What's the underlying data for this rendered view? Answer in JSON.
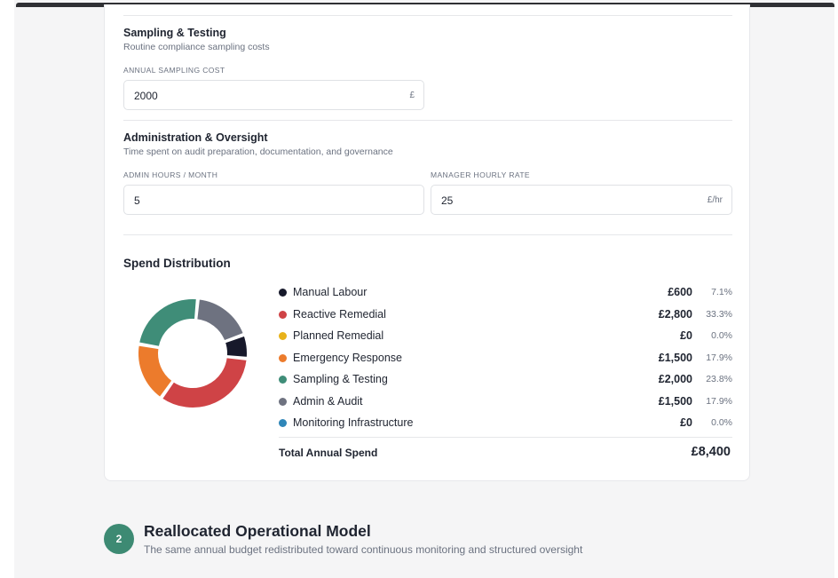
{
  "colors": {
    "manual_labour": "#17192b",
    "reactive_remedial": "#cf4346",
    "planned_remedial": "#e8b21a",
    "emergency_response": "#ec7b2c",
    "sampling_testing": "#3f8d78",
    "admin_audit": "#6e7280",
    "monitoring_infrastructure": "#2f86b8",
    "accent": "#3d8a73"
  },
  "sampling": {
    "title": "Sampling & Testing",
    "subtitle": "Routine compliance sampling costs",
    "cost_label": "ANNUAL SAMPLING COST",
    "cost_value": "2000",
    "cost_unit": "£"
  },
  "admin": {
    "title": "Administration & Oversight",
    "subtitle": "Time spent on audit preparation, documentation, and governance",
    "hours_label": "ADMIN HOURS / MONTH",
    "hours_value": "5",
    "rate_label": "MANAGER HOURLY RATE",
    "rate_value": "25",
    "rate_unit": "£/hr"
  },
  "distribution": {
    "title": "Spend Distribution",
    "items": [
      {
        "label": "Manual Labour",
        "amount": "£600",
        "percent": "7.1%",
        "color_key": "manual_labour",
        "fraction": 0.071
      },
      {
        "label": "Reactive Remedial",
        "amount": "£2,800",
        "percent": "33.3%",
        "color_key": "reactive_remedial",
        "fraction": 0.333
      },
      {
        "label": "Planned Remedial",
        "amount": "£0",
        "percent": "0.0%",
        "color_key": "planned_remedial",
        "fraction": 0.0
      },
      {
        "label": "Emergency Response",
        "amount": "£1,500",
        "percent": "17.9%",
        "color_key": "emergency_response",
        "fraction": 0.179
      },
      {
        "label": "Sampling & Testing",
        "amount": "£2,000",
        "percent": "23.8%",
        "color_key": "sampling_testing",
        "fraction": 0.238
      },
      {
        "label": "Admin & Audit",
        "amount": "£1,500",
        "percent": "17.9%",
        "color_key": "admin_audit",
        "fraction": 0.179
      },
      {
        "label": "Monitoring Infrastructure",
        "amount": "£0",
        "percent": "0.0%",
        "color_key": "monitoring_infrastructure",
        "fraction": 0.0
      }
    ],
    "total_label": "Total Annual Spend",
    "total_value": "£8,400"
  },
  "step2": {
    "number": "2",
    "title": "Reallocated Operational Model",
    "subtitle": "The same annual budget redistributed toward continuous monitoring and structured oversight"
  }
}
